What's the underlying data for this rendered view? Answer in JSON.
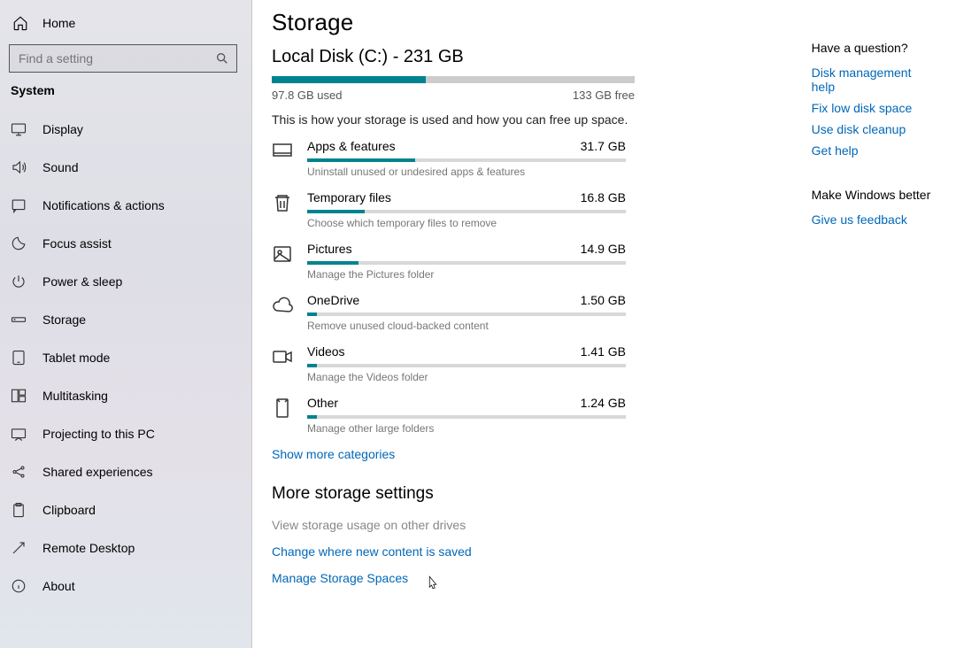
{
  "sidebar": {
    "home": "Home",
    "search_placeholder": "Find a setting",
    "section": "System",
    "items": [
      {
        "label": "Display",
        "icon": "display"
      },
      {
        "label": "Sound",
        "icon": "sound"
      },
      {
        "label": "Notifications & actions",
        "icon": "notifications"
      },
      {
        "label": "Focus assist",
        "icon": "focus"
      },
      {
        "label": "Power & sleep",
        "icon": "power"
      },
      {
        "label": "Storage",
        "icon": "storage"
      },
      {
        "label": "Tablet mode",
        "icon": "tablet"
      },
      {
        "label": "Multitasking",
        "icon": "multitask"
      },
      {
        "label": "Projecting to this PC",
        "icon": "project"
      },
      {
        "label": "Shared experiences",
        "icon": "shared"
      },
      {
        "label": "Clipboard",
        "icon": "clipboard"
      },
      {
        "label": "Remote Desktop",
        "icon": "remote"
      },
      {
        "label": "About",
        "icon": "about"
      }
    ]
  },
  "page": {
    "title": "Storage",
    "disk_title": "Local Disk (C:) - 231 GB",
    "used_label": "97.8 GB used",
    "free_label": "133 GB free",
    "used_pct": 42.4,
    "description": "This is how your storage is used and how you can free up space.",
    "categories": [
      {
        "name": "Apps & features",
        "size": "31.7 GB",
        "sub": "Uninstall unused or undesired apps & features",
        "pct": 34,
        "icon": "apps"
      },
      {
        "name": "Temporary files",
        "size": "16.8 GB",
        "sub": "Choose which temporary files to remove",
        "pct": 18,
        "icon": "temp"
      },
      {
        "name": "Pictures",
        "size": "14.9 GB",
        "sub": "Manage the Pictures folder",
        "pct": 16,
        "icon": "pictures"
      },
      {
        "name": "OneDrive",
        "size": "1.50 GB",
        "sub": "Remove unused cloud-backed content",
        "pct": 3,
        "icon": "onedrive"
      },
      {
        "name": "Videos",
        "size": "1.41 GB",
        "sub": "Manage the Videos folder",
        "pct": 3,
        "icon": "videos"
      },
      {
        "name": "Other",
        "size": "1.24 GB",
        "sub": "Manage other large folders",
        "pct": 3,
        "icon": "other"
      }
    ],
    "show_more": "Show more categories",
    "more_title": "More storage settings",
    "more_links": [
      {
        "label": "View storage usage on other drives",
        "muted": true
      },
      {
        "label": "Change where new content is saved",
        "muted": false
      },
      {
        "label": "Manage Storage Spaces",
        "muted": false
      }
    ]
  },
  "aside": {
    "q_title": "Have a question?",
    "q_links": [
      "Disk management help",
      "Fix low disk space",
      "Use disk cleanup",
      "Get help"
    ],
    "fb_title": "Make Windows better",
    "fb_link": "Give us feedback"
  }
}
